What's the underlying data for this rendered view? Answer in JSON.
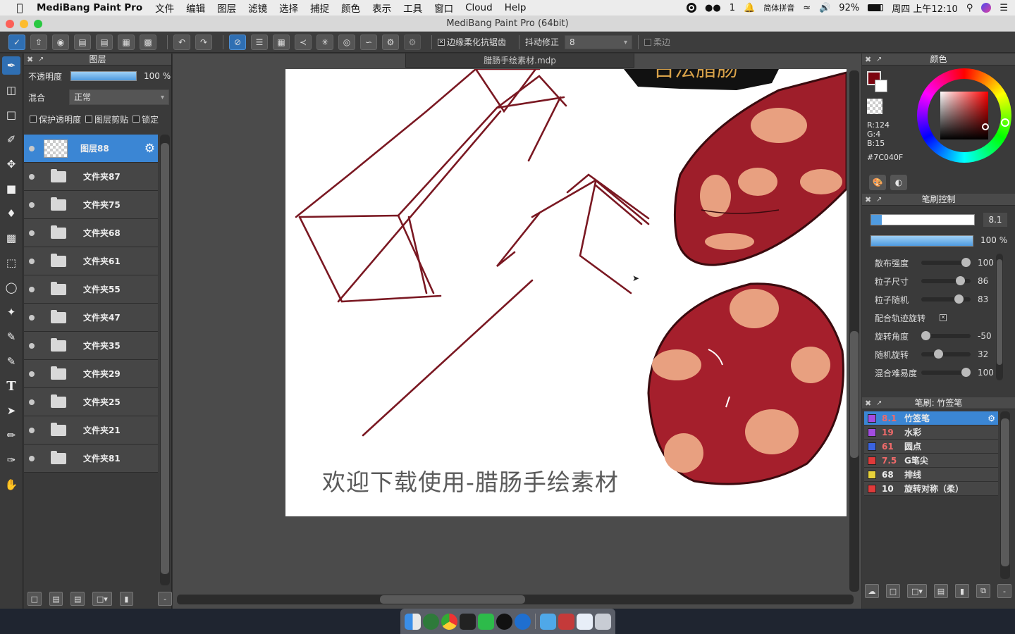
{
  "menubar": {
    "app": "MediBang Paint Pro",
    "items": [
      "文件",
      "编辑",
      "图层",
      "滤镜",
      "选择",
      "捕捉",
      "颜色",
      "表示",
      "工具",
      "窗口",
      "Cloud",
      "Help"
    ],
    "status": {
      "wechat_count": "1",
      "ime": "简体拼音",
      "battery": "92%",
      "clock": "周四 上午12:10"
    }
  },
  "window": {
    "title": "MediBang Paint Pro (64bit)"
  },
  "toolbar": {
    "antialias_label": "边缘柔化抗锯齿",
    "stabilizer_label": "抖动修正",
    "stabilizer_value": "8",
    "soft_edge_label": "柔边"
  },
  "layers_panel": {
    "title": "图层",
    "opacity_label": "不透明度",
    "opacity_value": "100 %",
    "blend_label": "混合",
    "blend_value": "正常",
    "protect_alpha": "保护透明度",
    "clipping": "图层剪贴",
    "lock": "锁定",
    "layers": [
      {
        "name": "图层88",
        "type": "layer",
        "selected": true
      },
      {
        "name": "文件夹87",
        "type": "folder"
      },
      {
        "name": "文件夹75",
        "type": "folder"
      },
      {
        "name": "文件夹68",
        "type": "folder"
      },
      {
        "name": "文件夹61",
        "type": "folder"
      },
      {
        "name": "文件夹55",
        "type": "folder"
      },
      {
        "name": "文件夹47",
        "type": "folder"
      },
      {
        "name": "文件夹35",
        "type": "folder"
      },
      {
        "name": "文件夹29",
        "type": "folder"
      },
      {
        "name": "文件夹25",
        "type": "folder"
      },
      {
        "name": "文件夹21",
        "type": "folder"
      },
      {
        "name": "文件夹81",
        "type": "folder"
      }
    ]
  },
  "document": {
    "tab": "腊肠手绘素材.mdp",
    "caption": "欢迎下载使用-腊肠手绘素材",
    "banner_text": "古法腊肠"
  },
  "color_panel": {
    "title": "颜色",
    "r": "R:124",
    "g": "G:4",
    "b": "B:15",
    "hex": "#7C040F",
    "current_color": "#7C040F"
  },
  "brush_control": {
    "title": "笔刷控制",
    "size_value": "8.1",
    "opacity_value": "100 %",
    "size_fraction": 0.1,
    "opacity_fraction": 1.0,
    "sliders": [
      {
        "label": "散布强度",
        "value": "100",
        "level": 1.0
      },
      {
        "label": "粒子尺寸",
        "value": "86",
        "level": 0.86
      },
      {
        "label": "粒子随机",
        "value": "83",
        "level": 0.83
      },
      {
        "label": "配合轨迹旋转",
        "value": "",
        "checkbox": true
      },
      {
        "label": "旋转角度",
        "value": "-50",
        "level": 0.0
      },
      {
        "label": "随机旋转",
        "value": "32",
        "level": 0.32
      },
      {
        "label": "混合难易度",
        "value": "100",
        "level": 1.0
      }
    ]
  },
  "brush_list": {
    "title": "笔刷: 竹签笔",
    "brushes": [
      {
        "size": "8.1",
        "name": "竹签笔",
        "color": "#a24ce0",
        "selected": true
      },
      {
        "size": "19",
        "name": "水彩",
        "color": "#a24ce0"
      },
      {
        "size": "61",
        "name": "圆点",
        "color": "#3a63e0"
      },
      {
        "size": "7.5",
        "name": "G笔尖",
        "color": "#e03a3a"
      },
      {
        "size": "68",
        "name": "排线",
        "color": "#e8d23a"
      },
      {
        "size": "10",
        "name": "旋转对称（柔）",
        "color": "#e03a3a"
      }
    ]
  }
}
